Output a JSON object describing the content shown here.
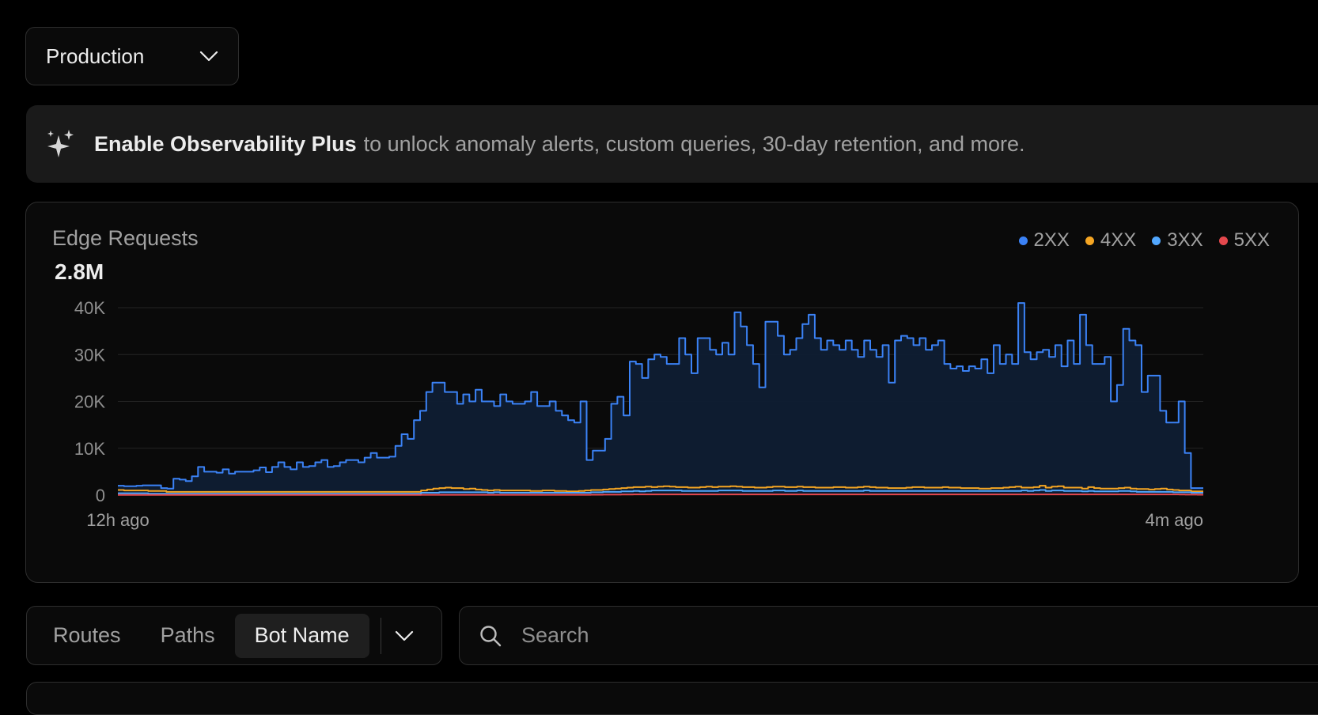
{
  "environment_select": {
    "value": "Production",
    "icon": "chevron-down-icon"
  },
  "banner": {
    "icon": "sparkles-icon",
    "strong_text": "Enable Observability Plus",
    "text": "to unlock anomaly alerts, custom queries, 30-day retention, and more."
  },
  "chart": {
    "title": "Edge Requests",
    "total": "2.8M",
    "legend": [
      {
        "label": "2XX",
        "color": "#3b82f6"
      },
      {
        "label": "4XX",
        "color": "#f5a623"
      },
      {
        "label": "3XX",
        "color": "#52a8ff"
      },
      {
        "label": "5XX",
        "color": "#e5484d"
      }
    ]
  },
  "chart_data": {
    "type": "area",
    "title": "Edge Requests",
    "x_start_label": "12h ago",
    "x_end_label": "4m ago",
    "yticks": [
      "0",
      "10K",
      "20K",
      "30K",
      "40K"
    ],
    "ylim": [
      0,
      40000
    ],
    "grid": true,
    "legend_position": "top-right",
    "series": [
      {
        "name": "2XX",
        "color": "#3b82f6",
        "values": [
          2000,
          1900,
          1900,
          2000,
          2100,
          2100,
          2100,
          1500,
          1400,
          3500,
          3300,
          3000,
          4000,
          6000,
          5000,
          5000,
          4800,
          5500,
          4600,
          5000,
          5000,
          5000,
          5300,
          5900,
          4900,
          6000,
          7000,
          6000,
          5500,
          7000,
          6000,
          6200,
          7000,
          7500,
          6000,
          6200,
          7000,
          7500,
          7500,
          7000,
          8000,
          9000,
          8000,
          8000,
          8200,
          10500,
          13000,
          12000,
          16000,
          18000,
          22000,
          24000,
          24000,
          22000,
          22000,
          19500,
          21500,
          20000,
          22500,
          20000,
          20000,
          19000,
          21500,
          20000,
          19500,
          19500,
          20000,
          22000,
          19000,
          19000,
          20000,
          18000,
          17000,
          16000,
          15500,
          20000,
          7500,
          9500,
          9500,
          12000,
          19500,
          21000,
          17000,
          28500,
          28000,
          25000,
          29000,
          30000,
          29500,
          28000,
          28000,
          33500,
          30000,
          26000,
          33500,
          33500,
          31000,
          30000,
          32500,
          30000,
          39000,
          36000,
          32000,
          28000,
          23000,
          37000,
          37000,
          34000,
          30000,
          31000,
          33500,
          36500,
          38500,
          33500,
          31000,
          33000,
          32000,
          31000,
          33000,
          31000,
          29500,
          33000,
          31000,
          29500,
          32000,
          24000,
          33000,
          34000,
          33500,
          32000,
          33500,
          31000,
          32000,
          33000,
          28000,
          27000,
          27500,
          26500,
          27500,
          27000,
          29000,
          26000,
          32000,
          28000,
          30000,
          28000,
          41000,
          30500,
          29000,
          30500,
          31000,
          29500,
          32000,
          27500,
          33000,
          28000,
          38500,
          32000,
          28000,
          28000,
          29500,
          20000,
          23500,
          35500,
          33000,
          32000,
          22000,
          25500,
          25500,
          18000,
          15500,
          15500,
          20000,
          9000,
          1500,
          1500
        ]
      },
      {
        "name": "4XX",
        "color": "#f5a623",
        "values": [
          1100,
          1000,
          1000,
          1000,
          1000,
          900,
          900,
          900,
          700,
          700,
          700,
          700,
          700,
          700,
          700,
          700,
          700,
          700,
          700,
          700,
          700,
          700,
          700,
          700,
          700,
          700,
          700,
          700,
          700,
          700,
          700,
          700,
          700,
          700,
          700,
          700,
          700,
          700,
          700,
          700,
          700,
          700,
          700,
          700,
          700,
          700,
          700,
          700,
          700,
          700,
          1000,
          1200,
          1400,
          1500,
          1600,
          1500,
          1500,
          1300,
          1400,
          1200,
          1100,
          1000,
          1100,
          1000,
          1000,
          1000,
          1000,
          1000,
          900,
          900,
          1000,
          1000,
          900,
          900,
          800,
          800,
          900,
          1000,
          1100,
          1100,
          1200,
          1300,
          1400,
          1500,
          1600,
          1700,
          1700,
          1800,
          1700,
          1800,
          1900,
          1800,
          1700,
          1700,
          1600,
          1600,
          1700,
          1800,
          1700,
          1800,
          1800,
          1900,
          1800,
          1700,
          1700,
          1600,
          1600,
          1700,
          1800,
          1800,
          1700,
          1700,
          1800,
          1700,
          1700,
          1600,
          1600,
          1600,
          1700,
          1700,
          1600,
          1600,
          1700,
          1800,
          1700,
          1600,
          1600,
          1500,
          1500,
          1500,
          1600,
          1700,
          1700,
          1600,
          1600,
          1600,
          1700,
          1600,
          1600,
          1500,
          1500,
          1500,
          1400,
          1400,
          1500,
          1500,
          1600,
          1700,
          1800,
          1600,
          1600,
          1700,
          2000,
          1600,
          1800,
          1900,
          1600,
          1600,
          1600,
          1400,
          1700,
          1500,
          1400,
          1400,
          1400,
          1500,
          1600,
          1400,
          1300,
          1300,
          1200,
          1300,
          1400,
          1200,
          1100,
          1000,
          1000,
          800,
          800
        ]
      },
      {
        "name": "3XX",
        "color": "#52a8ff",
        "values": [
          400,
          400,
          400,
          400,
          400,
          300,
          300,
          300,
          300,
          300,
          300,
          300,
          300,
          300,
          300,
          300,
          300,
          300,
          300,
          300,
          300,
          300,
          300,
          300,
          300,
          300,
          300,
          300,
          300,
          300,
          300,
          300,
          300,
          300,
          300,
          300,
          300,
          300,
          300,
          300,
          300,
          300,
          300,
          300,
          300,
          300,
          300,
          300,
          300,
          300,
          500,
          500,
          500,
          600,
          600,
          600,
          600,
          600,
          600,
          600,
          600,
          500,
          600,
          500,
          500,
          500,
          500,
          500,
          500,
          500,
          500,
          500,
          500,
          500,
          500,
          500,
          500,
          500,
          600,
          600,
          700,
          700,
          700,
          800,
          800,
          900,
          800,
          900,
          1000,
          1000,
          1000,
          1000,
          1000,
          900,
          900,
          900,
          900,
          900,
          900,
          1000,
          1000,
          1000,
          1000,
          900,
          900,
          900,
          900,
          900,
          1000,
          1000,
          900,
          900,
          1000,
          900,
          900,
          900,
          900,
          900,
          900,
          900,
          900,
          900,
          900,
          1000,
          900,
          900,
          900,
          900,
          900,
          900,
          900,
          900,
          900,
          900,
          900,
          900,
          900,
          900,
          900,
          900,
          900,
          900,
          900,
          900,
          900,
          900,
          900,
          900,
          900,
          1000,
          900,
          1000,
          1100,
          900,
          1000,
          1000,
          900,
          900,
          900,
          800,
          900,
          800,
          800,
          800,
          800,
          900,
          900,
          800,
          700,
          700,
          700,
          700,
          700,
          700,
          600,
          600,
          600,
          500,
          500
        ]
      },
      {
        "name": "5XX",
        "color": "#e5484d",
        "values": [
          50,
          50,
          50,
          50,
          50,
          50,
          50,
          50,
          50,
          50,
          50,
          50,
          50,
          50,
          50,
          50,
          50,
          50,
          50,
          50,
          50,
          50,
          50,
          50,
          50,
          50,
          50,
          50,
          50,
          50,
          50,
          50,
          50,
          50,
          50,
          50,
          50,
          50,
          50,
          50,
          50,
          50,
          50,
          50,
          50,
          50,
          50,
          50,
          50,
          50,
          60,
          60,
          60,
          60,
          60,
          60,
          60,
          60,
          60,
          60,
          60,
          60,
          60,
          60,
          60,
          60,
          60,
          60,
          60,
          60,
          60,
          60,
          60,
          60,
          60,
          60,
          60,
          60,
          80,
          80,
          100,
          100,
          100,
          120,
          120,
          150,
          150,
          150,
          150,
          150,
          150,
          150,
          150,
          150,
          150,
          150,
          150,
          150,
          150,
          150,
          150,
          150,
          150,
          150,
          150,
          150,
          150,
          150,
          150,
          150,
          150,
          150,
          150,
          150,
          150,
          150,
          150,
          150,
          150,
          150,
          150,
          150,
          150,
          150,
          150,
          150,
          150,
          150,
          150,
          150,
          150,
          150,
          150,
          150,
          150,
          150,
          150,
          150,
          150,
          150,
          150,
          150,
          150,
          150,
          150,
          150,
          150,
          150,
          150,
          150,
          150,
          150,
          150,
          150,
          150,
          150,
          150,
          150,
          150,
          150,
          150,
          150,
          150,
          150,
          150,
          150,
          150,
          150,
          150,
          150,
          150,
          150,
          150,
          150,
          150,
          120,
          100,
          100,
          80
        ]
      }
    ]
  },
  "tabs": {
    "items": [
      "Routes",
      "Paths",
      "Bot Name"
    ],
    "active": "Bot Name",
    "more_icon": "chevron-down-icon"
  },
  "search": {
    "placeholder": "Search",
    "value": "",
    "icon": "search-icon"
  }
}
